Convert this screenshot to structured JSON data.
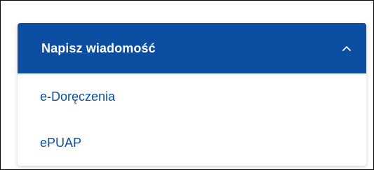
{
  "dropdown": {
    "title": "Napisz wiadomość",
    "expanded": true,
    "items": [
      {
        "label": "e-Doręczenia"
      },
      {
        "label": "ePUAP"
      }
    ]
  },
  "colors": {
    "accent": "#0b4ea2",
    "header_text": "#ffffff",
    "item_text": "#0b4ea2"
  },
  "icons": {
    "toggle": "chevron-up-icon"
  }
}
